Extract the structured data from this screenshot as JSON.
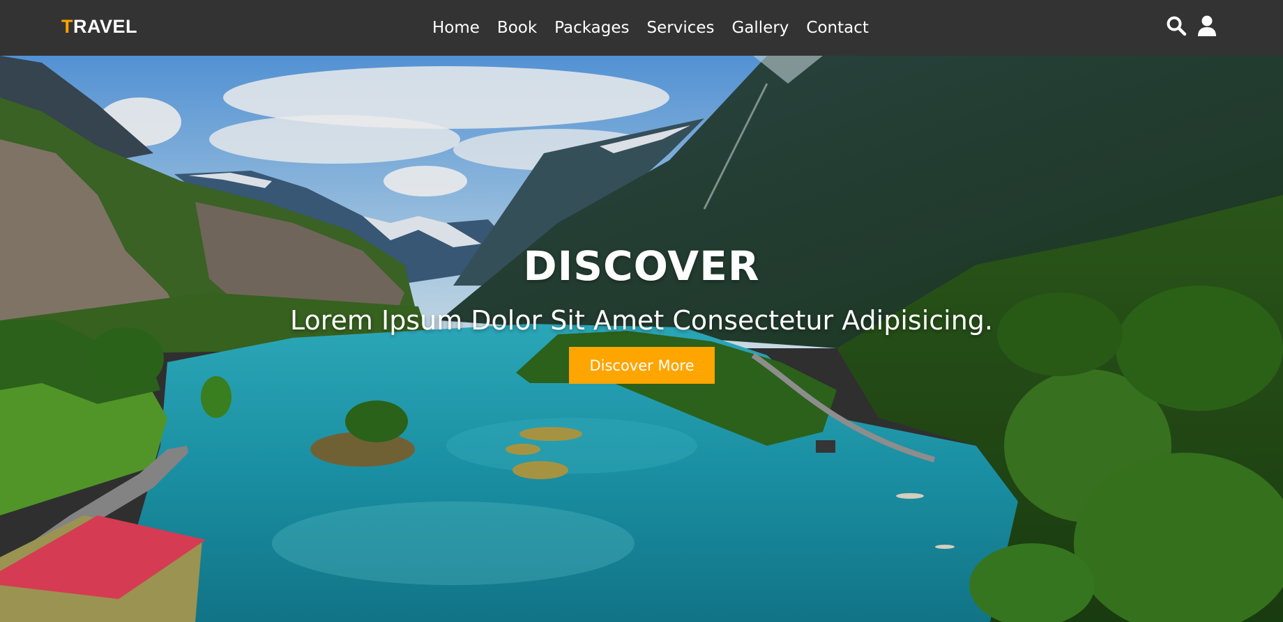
{
  "brand": {
    "logo_first_letter": "T",
    "logo_rest": "RAVEL",
    "accent_color": "#ffa500"
  },
  "nav": {
    "items": [
      {
        "label": "Home"
      },
      {
        "label": "Book"
      },
      {
        "label": "Packages"
      },
      {
        "label": "Services"
      },
      {
        "label": "Gallery"
      },
      {
        "label": "Contact"
      }
    ],
    "icons": [
      "search-icon",
      "user-icon"
    ]
  },
  "hero": {
    "title": "DISCOVER",
    "subtitle": "Lorem Ipsum Dolor Sit Amet Consectetur Adipisicing.",
    "button_label": "Discover More",
    "button_color": "#ffa500"
  },
  "colors": {
    "navbar_bg": "#333333",
    "text": "#ffffff"
  }
}
